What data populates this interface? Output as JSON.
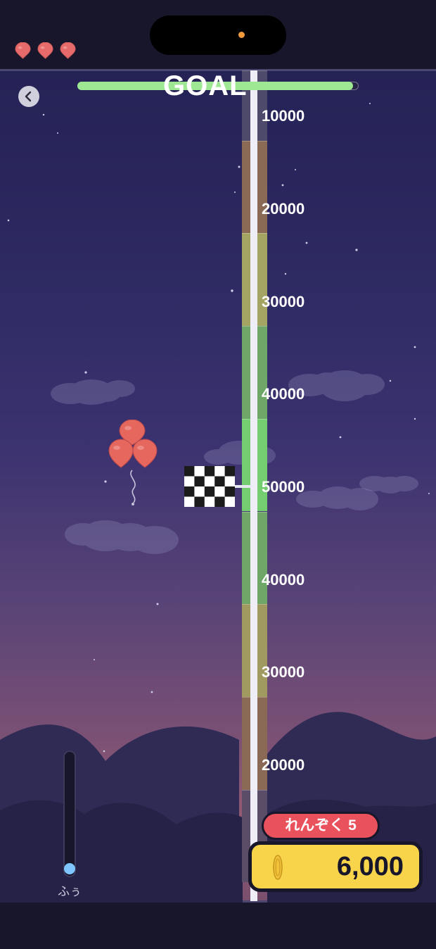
{
  "hud": {
    "lives": 3,
    "life_color": "#e86b6b",
    "goal_label": "GOAL",
    "progress": 0.98,
    "streak_label": "れんぞく 5",
    "coins": "6,000",
    "wind_label": "ふぅ",
    "wind_level": 0.0
  },
  "meter": {
    "labels": [
      "10000",
      "20000",
      "30000",
      "40000",
      "50000",
      "40000",
      "30000",
      "20000"
    ],
    "segment_colors": [
      "#4e4a6c",
      "#8a6a55",
      "#a4a562",
      "#6ea768",
      "#74cd6e",
      "#6ea768",
      "#a09a60",
      "#8a6a55",
      "#5a4d68"
    ]
  },
  "icons": {
    "back": "chevron-left-icon",
    "life": "balloon-icon",
    "coin": "coin-icon",
    "flag": "checkered-flag-icon"
  }
}
